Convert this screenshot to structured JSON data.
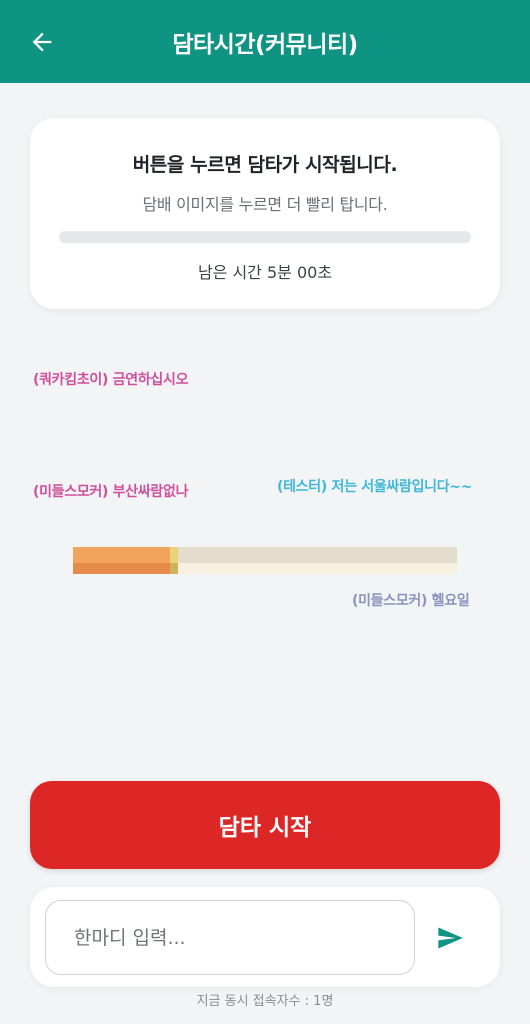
{
  "header": {
    "title": "담타시간(커뮤니티)",
    "back_icon": "arrow-left-icon",
    "color": "#0f9383"
  },
  "info_card": {
    "title": "버튼을 누르면 담타가 시작됩니다.",
    "subtitle": "담배 이미지를 누르면 더 빨리 탑니다.",
    "progress": 0,
    "remaining_text": "남은 시간 5분 00초"
  },
  "messages": [
    {
      "text": "(쿼카킴초이) 금연하십시오",
      "color": "#d04f9e"
    },
    {
      "text": "(미들스모커) 부산싸람없나",
      "color": "#d04f9e"
    },
    {
      "text": "(테스터) 저는 서울싸람입니다~~",
      "color": "#3eb8d8"
    },
    {
      "text": "(미들스모커) 헬요일",
      "color": "#8a94bd"
    }
  ],
  "cigarette": {
    "icon": "cigarette-icon"
  },
  "start_button": {
    "label": "담타 시작",
    "color": "#dd2626"
  },
  "chat": {
    "placeholder": "한마디 입력...",
    "value": "",
    "send_icon": "send-icon"
  },
  "footer": {
    "concurrent_users": "지금 동시 접속자수 : 1명"
  }
}
